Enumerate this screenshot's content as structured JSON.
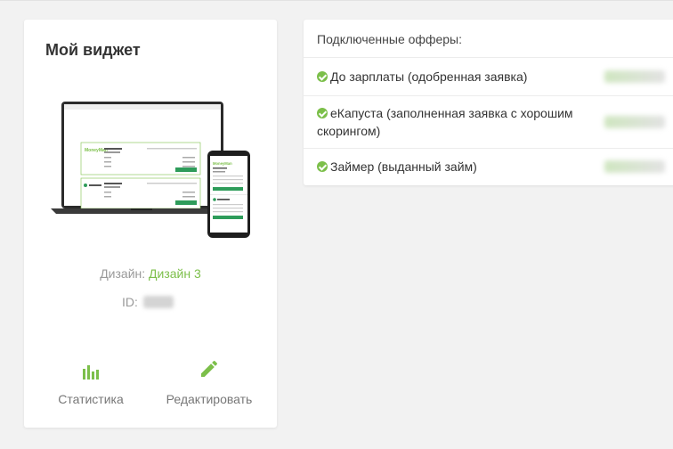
{
  "widget": {
    "title": "Мой виджет",
    "design_label": "Дизайн:",
    "design_value": "Дизайн 3",
    "id_label": "ID:",
    "preview_brand": "MoneyMan",
    "actions": {
      "stats_label": "Статистика",
      "edit_label": "Редактировать",
      "stats_icon": "bar-chart-icon",
      "edit_icon": "pencil-icon"
    }
  },
  "offers": {
    "header": "Подключенные офферы:",
    "items": [
      {
        "label": "До зарплаты (одобренная заявка)",
        "icon": "check-circle-icon"
      },
      {
        "label": "еКапуста (заполненная заявка с хорошим скорингом)",
        "icon": "check-circle-icon"
      },
      {
        "label": "Займер (выданный займ)",
        "icon": "check-circle-icon"
      }
    ]
  },
  "colors": {
    "accent": "#7cbf4a",
    "background": "#f2f2f2",
    "card": "#ffffff",
    "muted_text": "#999999"
  }
}
